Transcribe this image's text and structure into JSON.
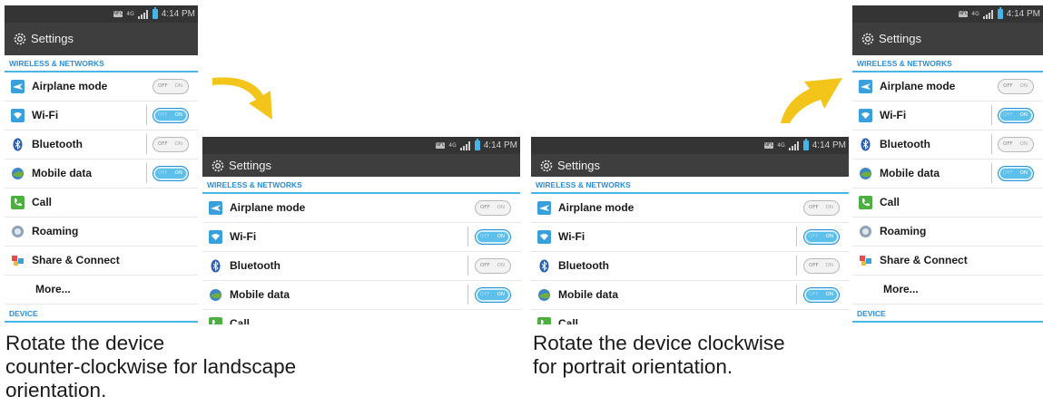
{
  "status_bar": {
    "nfc": "NFC",
    "network": "4G",
    "time": "4:14 PM"
  },
  "title": "Settings",
  "sections": {
    "wireless": "WIRELESS & NETWORKS",
    "device": "DEVICE"
  },
  "items": {
    "airplane": "Airplane mode",
    "wifi": "Wi-Fi",
    "bluetooth": "Bluetooth",
    "mobile_data": "Mobile data",
    "call": "Call",
    "roaming": "Roaming",
    "share": "Share & Connect",
    "more": "More..."
  },
  "toggle": {
    "off": "OFF",
    "on": "ON"
  },
  "toggle_states": {
    "airplane": false,
    "wifi": true,
    "bluetooth": false,
    "mobile_data": true
  },
  "captions": {
    "left": [
      "Rotate the device",
      "counter-clockwise for landscape",
      "orientation."
    ],
    "right": [
      "Rotate the device clockwise",
      "for portrait orientation."
    ]
  },
  "colors": {
    "accent": "#2b8fd6",
    "arrow": "#f3c51a",
    "statusbar": "#343434",
    "titlebar": "#3e3e3e"
  },
  "icons": [
    "gear-icon",
    "airplane-icon",
    "wifi-icon",
    "bluetooth-icon",
    "mobile-data-icon",
    "call-icon",
    "roaming-icon",
    "share-connect-icon",
    "arrow-curved-icon"
  ]
}
